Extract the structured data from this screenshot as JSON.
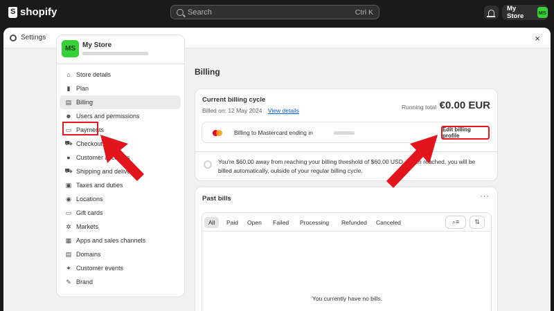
{
  "topbar": {
    "logo_text": "shopify",
    "search_placeholder": "Search",
    "search_shortcut": "Ctrl K",
    "store_name": "My Store",
    "store_initials": "MS"
  },
  "modal": {
    "title": "Settings",
    "close_label": "×"
  },
  "sidebar": {
    "store_name": "My Store",
    "store_initials": "MS",
    "items": [
      {
        "label": "Store details",
        "icon": "store-icon"
      },
      {
        "label": "Plan",
        "icon": "plan-icon"
      },
      {
        "label": "Billing",
        "icon": "billing-icon"
      },
      {
        "label": "Users and permissions",
        "icon": "users-icon"
      },
      {
        "label": "Payments",
        "icon": "payments-icon"
      },
      {
        "label": "Checkout",
        "icon": "cart-icon"
      },
      {
        "label": "Customer accounts",
        "icon": "person-icon"
      },
      {
        "label": "Shipping and delivery",
        "icon": "truck-icon"
      },
      {
        "label": "Taxes and duties",
        "icon": "tax-icon"
      },
      {
        "label": "Locations",
        "icon": "location-icon"
      },
      {
        "label": "Gift cards",
        "icon": "gift-card-icon"
      },
      {
        "label": "Markets",
        "icon": "globe-icon"
      },
      {
        "label": "Apps and sales channels",
        "icon": "apps-icon"
      },
      {
        "label": "Domains",
        "icon": "domain-icon"
      },
      {
        "label": "Customer events",
        "icon": "events-icon"
      },
      {
        "label": "Brand",
        "icon": "brand-icon"
      }
    ]
  },
  "main": {
    "page_title": "Billing",
    "cycle": {
      "title": "Current billing cycle",
      "billed_on": "Billed on: 12 May 2024",
      "view_details": "View details",
      "running_total_label": "Running total",
      "running_total_value": "€0.00 EUR",
      "payment_method": "Billing to Mastercard ending in",
      "edit_button": "Edit billing profile",
      "threshold_text": "You're $60.00 away from reaching your billing threshold of $60.00 USD. When reached, you will be billed automatically, outside of your regular billing cycle."
    },
    "past_bills": {
      "title": "Past bills",
      "more_label": "···",
      "tabs": [
        "All",
        "Paid",
        "Open",
        "Failed",
        "Processing",
        "Refunded",
        "Canceled"
      ],
      "empty_text": "You currently have no bills."
    }
  },
  "colors": {
    "accent_red": "#e3151c",
    "store_green": "#36d136",
    "link_blue": "#005bd3"
  }
}
